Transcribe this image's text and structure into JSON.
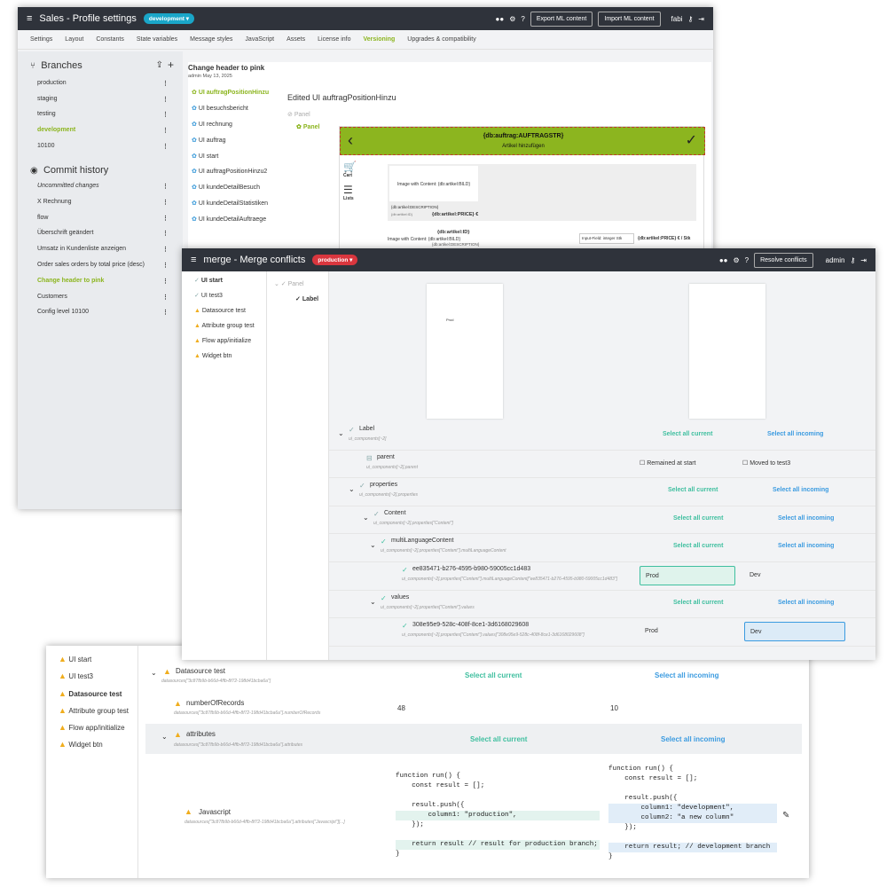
{
  "win1": {
    "title": "Sales - Profile settings",
    "badge": "development ▾",
    "export_btn": "Export ML content",
    "import_btn": "Import ML content",
    "user": "fabi",
    "tabs": [
      "Settings",
      "Layout",
      "Constants",
      "State variables",
      "Message styles",
      "JavaScript",
      "Assets",
      "License info",
      "Versioning",
      "Upgrades & compatibility"
    ],
    "branches_title": "Branches",
    "branches": [
      "production",
      "staging",
      "testing",
      "development",
      "10100"
    ],
    "commit_title": "Commit history",
    "commits": [
      "Uncommitted changes",
      "X Rechnung",
      "flow",
      "Überschrift geändert",
      "Umsatz in Kundenliste anzeigen",
      "Order sales orders by total price (desc)",
      "Change header to pink",
      "Customers",
      "Config level 10100"
    ],
    "commit_header": "Change header to pink",
    "commit_meta": "admin May 13, 2025",
    "ui_list": [
      "UI auftragPositionHinzu",
      "UI besuchsbericht",
      "UI rechnung",
      "UI auftrag",
      "UI start",
      "UI auftragPositionHinzu2",
      "UI kundeDetailBesuch",
      "UI kundeDetailStatistiken",
      "UI kundeDetailAuftraege"
    ],
    "edited_title": "Edited UI auftragPositionHinzu",
    "tree_panel1": "Panel",
    "tree_panel2": "Panel",
    "preview_header": "{db:auftrag:AUFTRAGSTR}",
    "preview_sub": "Artikel hinzufügen",
    "cart_label": "Cart",
    "lists_label": "Lists",
    "img_content": "Image with Content: {db:artikel:BILD}",
    "desc1": "{db:artikel:DESCRIPTION}",
    "db_small": "{db:artikel:ID}",
    "price": "{db:artikel:PRICE} €",
    "row2_id": "{db:artikel:ID}",
    "row2_img": "Image with Content: {db:artikel:BILD}",
    "row2_desc": "{db:artikel:DESCRIPTION}",
    "row2_input": "Input-Field: integer",
    "row2_stk": "Stk",
    "row2_price": "{db:artikel:PRICE} € / Stk"
  },
  "win2": {
    "title": "merge - Merge conflicts",
    "badge": "production ▾",
    "resolve_btn": "Resolve conflicts",
    "user": "admin",
    "left_items": [
      {
        "label": "UI start",
        "icon": "check",
        "active": true
      },
      {
        "label": "UI test3",
        "icon": "check",
        "active": false
      },
      {
        "label": "Datasource test",
        "icon": "warn",
        "active": false
      },
      {
        "label": "Attribute group test",
        "icon": "warn",
        "active": false
      },
      {
        "label": "Flow app/initialize",
        "icon": "warn",
        "active": false
      },
      {
        "label": "Widget btn",
        "icon": "warn",
        "active": false
      }
    ],
    "tree_panel": "Panel",
    "tree_label": "Label",
    "preview_text": "Prod",
    "rows": [
      {
        "label": "Label",
        "path": "ui_components[~2]",
        "current": "Select all current",
        "incoming": "Select all incoming"
      },
      {
        "label": "parent",
        "path": "ui_components[~2].parent",
        "current": "Remained at start",
        "incoming": "Moved to test3"
      },
      {
        "label": "properties",
        "path": "ui_components[~2].properties",
        "current": "Select all current",
        "incoming": "Select all incoming"
      },
      {
        "label": "Content",
        "path": "ui_components[~2].properties[\"Content\"]",
        "current": "Select all current",
        "incoming": "Select all incoming"
      },
      {
        "label": "multiLanguageContent",
        "path": "ui_components[~2].properties[\"Content\"].multiLanguageContent",
        "current": "Select all current",
        "incoming": "Select all incoming"
      },
      {
        "label": "ee835471-b276-4595-b980-59005cc1d483",
        "path": "ui_components[~2].properties[\"Content\"].multiLanguageContent[\"ee835471-b276-4595-b980-59005cc1d483\"]",
        "current": "Prod",
        "incoming": "Dev"
      },
      {
        "label": "values",
        "path": "ui_components[~2].properties[\"Content\"].values",
        "current": "Select all current",
        "incoming": "Select all incoming"
      },
      {
        "label": "308e95e9-528c-408f-8ce1-3d6168029608",
        "path": "ui_components[~2].properties[\"Content\"].values[\"308e95e9-528c-408f-8ce1-3d6168029608\"]",
        "current": "Prod",
        "incoming": "Dev"
      }
    ]
  },
  "win3": {
    "left_items": [
      "UI start",
      "UI test3",
      "Datasource test",
      "Attribute group test",
      "Flow app/initialize",
      "Widget btn"
    ],
    "ds_label": "Datasource test",
    "ds_path": "datasources[\"3c87fb9b-b66d-4ffb-8f72-198d41bcba6a\"]",
    "ds_current": "Select all current",
    "ds_incoming": "Select all incoming",
    "nr_label": "numberOfRecords",
    "nr_path": "datasources[\"3c87fb9b-b66d-4ffb-8f72-198d41bcba6a\"].numberOfRecords",
    "nr_current": "48",
    "nr_incoming": "10",
    "attr_label": "attributes",
    "attr_path": "datasources[\"3c87fb9b-b66d-4ffb-8f72-198d41bcba6a\"].attributes",
    "attr_current": "Select all current",
    "attr_incoming": "Select all incoming",
    "js_label": "Javascript",
    "js_path": "datasources[\"3c87fb9b-b66d-4ffb-8f72-198d41bcba6a\"].attributes[\"Javascript\"][...]",
    "code_left": [
      {
        "t": "function run() {",
        "hl": false
      },
      {
        "t": "    const result = [];",
        "hl": false
      },
      {
        "t": "",
        "hl": false
      },
      {
        "t": "    result.push({",
        "hl": false
      },
      {
        "t": "        column1: \"production\",",
        "hl": true
      },
      {
        "t": "    });",
        "hl": false
      },
      {
        "t": "",
        "hl": false
      },
      {
        "t": "    return result // result for production branch;",
        "hl": true
      },
      {
        "t": "}",
        "hl": false
      }
    ],
    "code_right": [
      {
        "t": "function run() {",
        "hl": false
      },
      {
        "t": "    const result = [];",
        "hl": false
      },
      {
        "t": "",
        "hl": false
      },
      {
        "t": "    result.push({",
        "hl": false
      },
      {
        "t": "        column1: \"development\",",
        "hl": true
      },
      {
        "t": "        column2: \"a new column\"",
        "hl": true
      },
      {
        "t": "    });",
        "hl": false
      },
      {
        "t": "",
        "hl": false
      },
      {
        "t": "    return result; // development branch",
        "hl": true
      },
      {
        "t": "}",
        "hl": false
      }
    ]
  }
}
